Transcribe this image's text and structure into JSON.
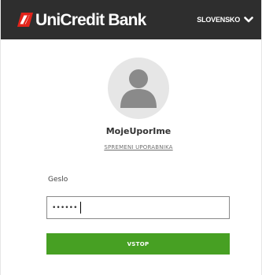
{
  "header": {
    "brand_name": "UniCredit Bank",
    "language": "SLOVENSKO",
    "background_color": "#2e2e2e",
    "logo_color": "#e2231a"
  },
  "profile": {
    "username": "MojeUporIme",
    "change_user_link": "SPREMENI UPORABNIKA"
  },
  "login_form": {
    "password_label": "Geslo",
    "password_value": "••••••",
    "submit_label": "VSTOP",
    "submit_color": "#47a023"
  },
  "icons": {
    "logo": "unicredit-logo-icon",
    "language_toggle": "chevron-down-icon",
    "avatar": "user-avatar-icon"
  }
}
